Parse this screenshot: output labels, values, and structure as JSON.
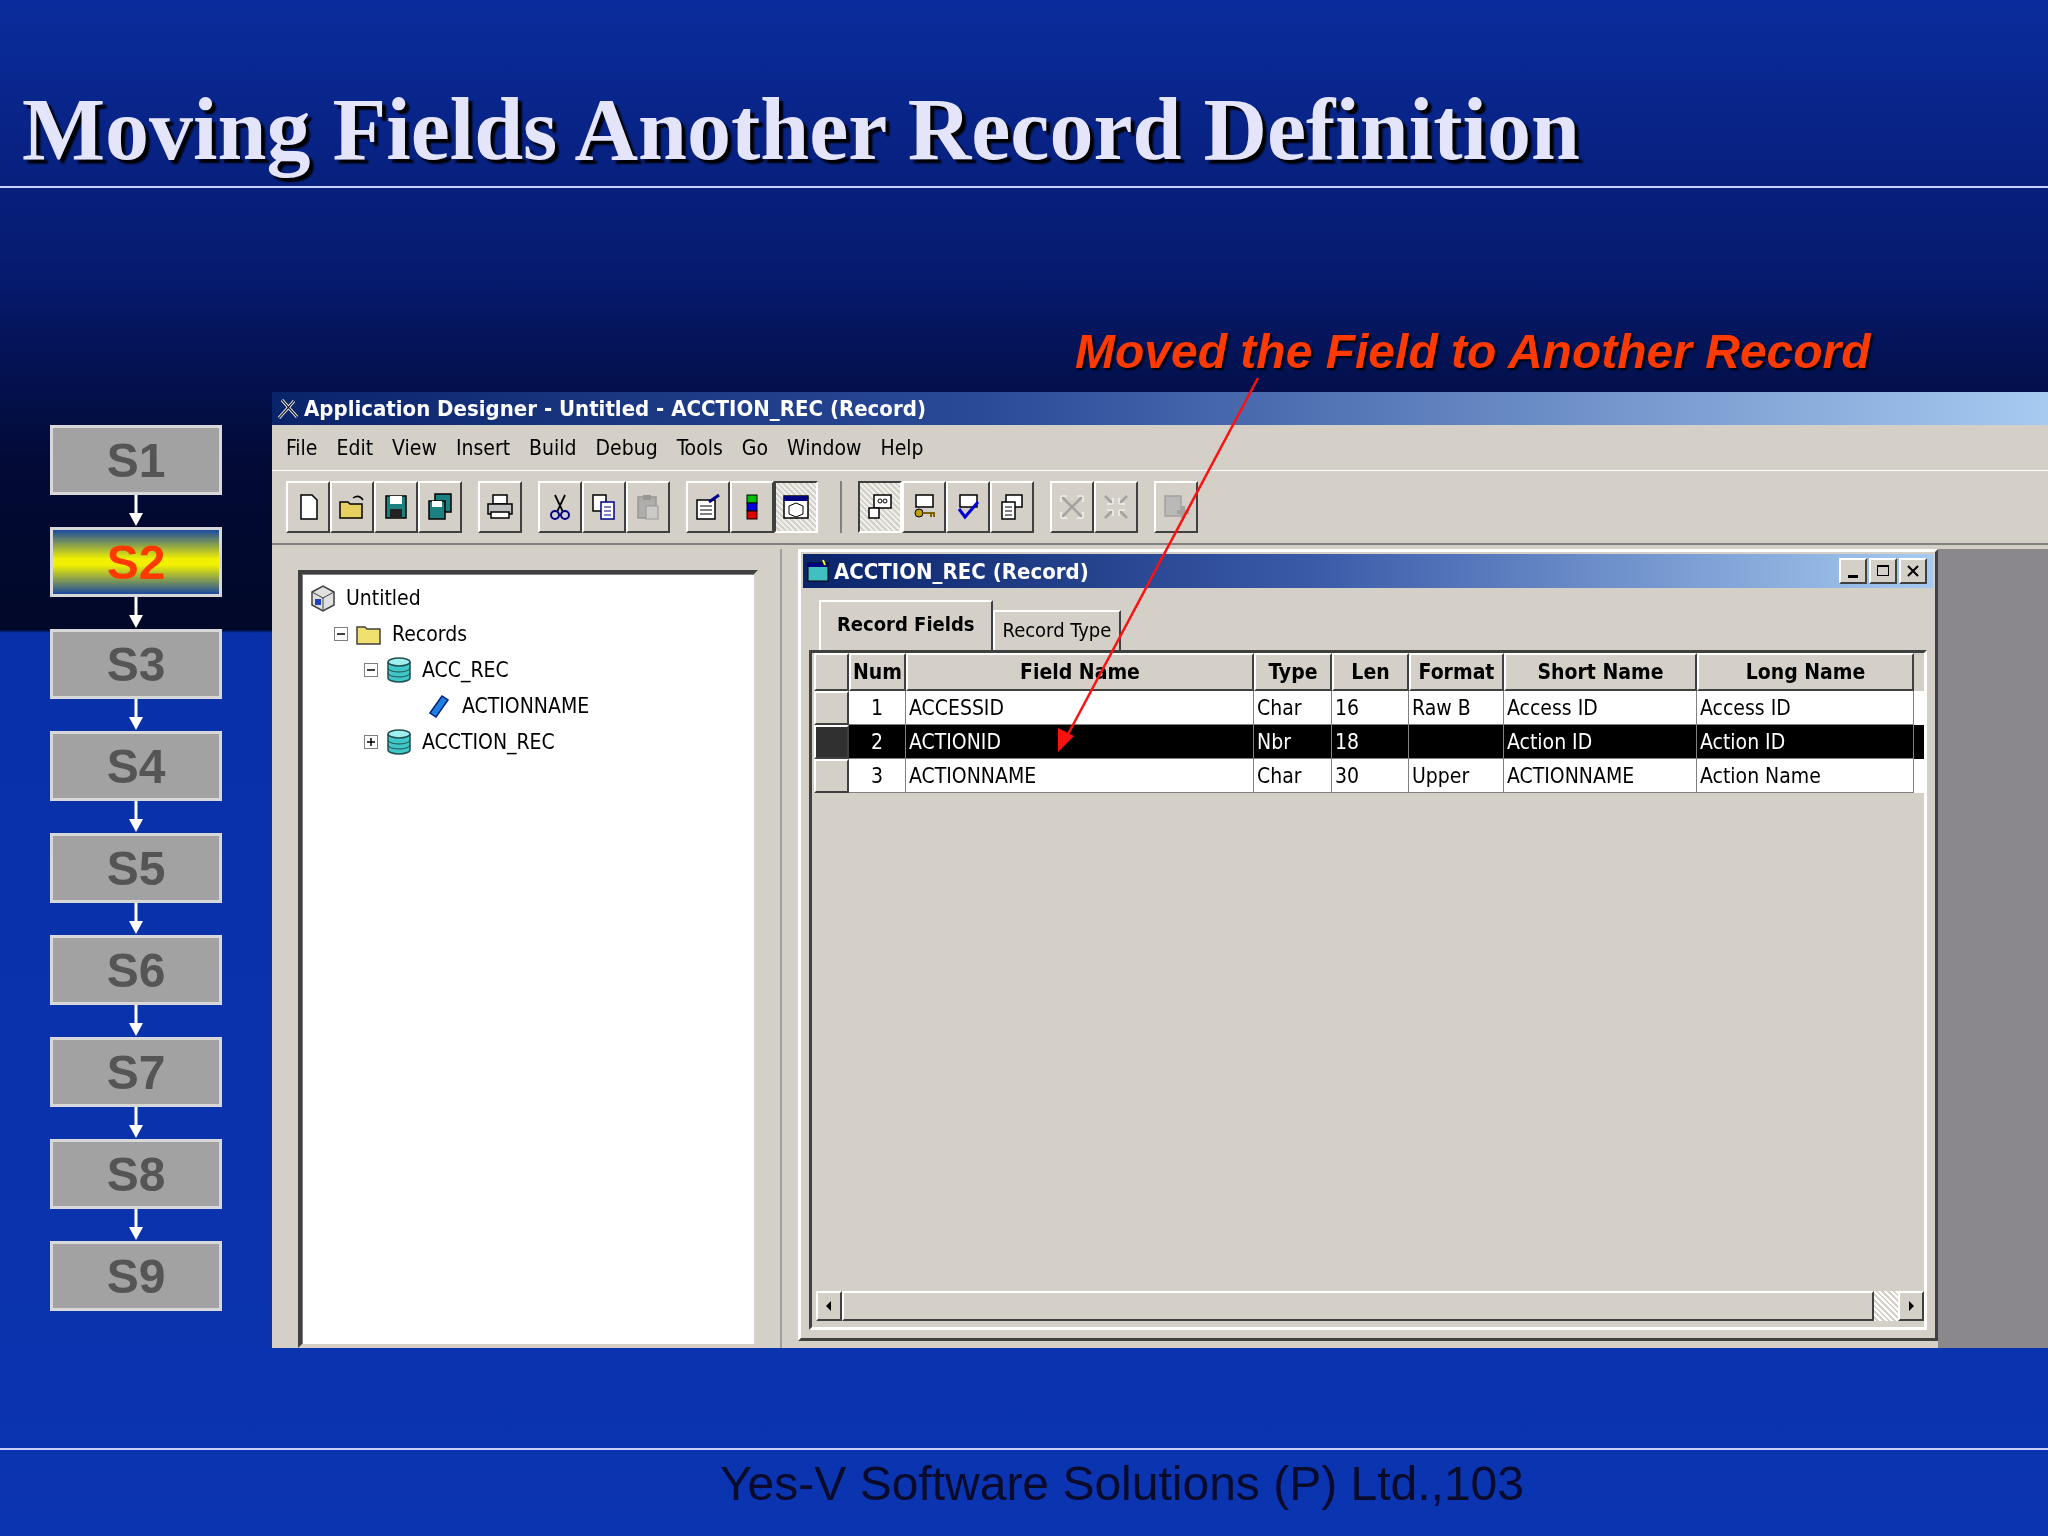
{
  "slide": {
    "title": "Moving Fields Another Record Definition",
    "annotation": "Moved the Field to Another Record",
    "footer": "Yes-V Software Solutions (P) Ltd.,103"
  },
  "steps": [
    {
      "label": "S1",
      "selected": false
    },
    {
      "label": "S2",
      "selected": true
    },
    {
      "label": "S3",
      "selected": false
    },
    {
      "label": "S4",
      "selected": false
    },
    {
      "label": "S5",
      "selected": false
    },
    {
      "label": "S6",
      "selected": false
    },
    {
      "label": "S7",
      "selected": false
    },
    {
      "label": "S8",
      "selected": false
    },
    {
      "label": "S9",
      "selected": false
    }
  ],
  "window": {
    "title": "Application Designer - Untitled - ACCTION_REC (Record)",
    "menu": [
      "File",
      "Edit",
      "View",
      "Insert",
      "Build",
      "Debug",
      "Tools",
      "Go",
      "Window",
      "Help"
    ],
    "toolbar": [
      [
        {
          "kind": "new",
          "disabled": false,
          "pressed": false
        },
        {
          "kind": "open",
          "disabled": false,
          "pressed": false
        },
        {
          "kind": "save",
          "disabled": false,
          "pressed": false
        },
        {
          "kind": "save-all",
          "disabled": false,
          "pressed": false
        }
      ],
      [
        {
          "kind": "print",
          "disabled": false,
          "pressed": false
        }
      ],
      [
        {
          "kind": "cut",
          "disabled": false,
          "pressed": false
        },
        {
          "kind": "copy",
          "disabled": false,
          "pressed": false
        },
        {
          "kind": "paste",
          "disabled": true,
          "pressed": false
        }
      ],
      [
        {
          "kind": "properties",
          "disabled": false,
          "pressed": false
        },
        {
          "kind": "blocks",
          "disabled": false,
          "pressed": false
        },
        {
          "kind": "window",
          "disabled": false,
          "pressed": true
        }
      ],
      [
        {
          "kind": "card",
          "disabled": false,
          "pressed": true
        },
        {
          "kind": "key",
          "disabled": false,
          "pressed": false
        },
        {
          "kind": "check",
          "disabled": false,
          "pressed": false
        },
        {
          "kind": "list",
          "disabled": false,
          "pressed": false
        }
      ],
      [
        {
          "kind": "expand",
          "disabled": true,
          "pressed": false
        },
        {
          "kind": "collapse",
          "disabled": true,
          "pressed": false
        }
      ],
      [
        {
          "kind": "insert",
          "disabled": true,
          "pressed": false
        }
      ]
    ],
    "tree": [
      {
        "label": "Untitled",
        "kind": "project",
        "children": [
          {
            "label": "Records",
            "kind": "folder",
            "expanded": true,
            "children": [
              {
                "label": "ACC_REC",
                "kind": "record",
                "expanded": true,
                "children": [
                  {
                    "label": "ACTIONNAME",
                    "kind": "field"
                  }
                ]
              },
              {
                "label": "ACCTION_REC",
                "kind": "record",
                "expanded": false
              }
            ]
          }
        ]
      }
    ],
    "record_window": {
      "title": "ACCTION_REC (Record)",
      "tabs": [
        {
          "label": "Record Fields",
          "selected": true
        },
        {
          "label": "Record Type",
          "selected": false
        }
      ],
      "columns": [
        "Num",
        "Field Name",
        "Type",
        "Len",
        "Format",
        "Short Name",
        "Long Name"
      ],
      "rows": [
        {
          "cells": [
            "1",
            "ACCESSID",
            "Char",
            "16",
            "Raw B",
            "Access ID",
            "Access ID"
          ],
          "selected": false
        },
        {
          "cells": [
            "2",
            "ACTIONID",
            "Nbr",
            "18",
            "",
            "Action ID",
            "Action ID"
          ],
          "selected": true
        },
        {
          "cells": [
            "3",
            "ACTIONNAME",
            "Char",
            "30",
            "Upper",
            "ACTIONNAME",
            "Action Name"
          ],
          "selected": false
        }
      ]
    }
  }
}
